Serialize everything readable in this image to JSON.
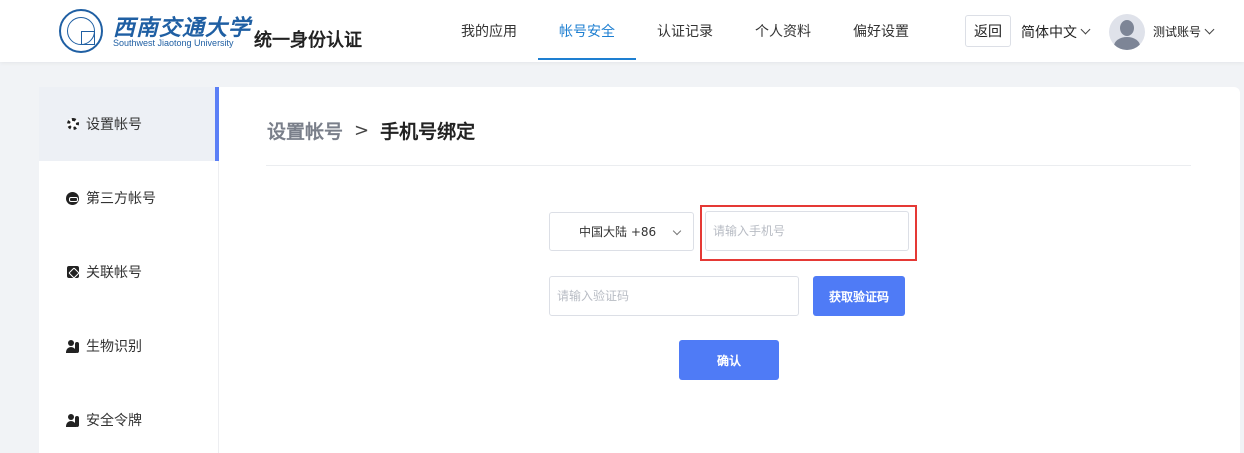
{
  "header": {
    "logo_cn": "西南交通大学",
    "logo_en": "Southwest Jiaotong University",
    "app_title": "统一身份认证",
    "nav": [
      {
        "label": "我的应用",
        "active": false
      },
      {
        "label": "帐号安全",
        "active": true
      },
      {
        "label": "认证记录",
        "active": false
      },
      {
        "label": "个人资料",
        "active": false
      },
      {
        "label": "偏好设置",
        "active": false
      }
    ],
    "back_label": "返回",
    "language": "简体中文",
    "username": "测试账号",
    "accent_color": "#1e7fd1"
  },
  "sidebar": {
    "items": [
      {
        "label": "设置帐号",
        "icon": "gear-icon",
        "active": true
      },
      {
        "label": "第三方帐号",
        "icon": "link-icon",
        "active": false
      },
      {
        "label": "关联帐号",
        "icon": "chain-icon",
        "active": false
      },
      {
        "label": "生物识别",
        "icon": "user-icon",
        "active": false
      },
      {
        "label": "安全令牌",
        "icon": "user-icon",
        "active": false
      }
    ]
  },
  "main": {
    "breadcrumb_parent": "设置帐号",
    "breadcrumb_sep": ">",
    "breadcrumb_current": "手机号绑定",
    "country_select": "中国大陆 +86",
    "phone_placeholder": "请输入手机号",
    "code_placeholder": "请输入验证码",
    "get_code_label": "获取验证码",
    "confirm_label": "确认",
    "button_color": "#4f7bf6",
    "highlight_color": "#e53935"
  }
}
